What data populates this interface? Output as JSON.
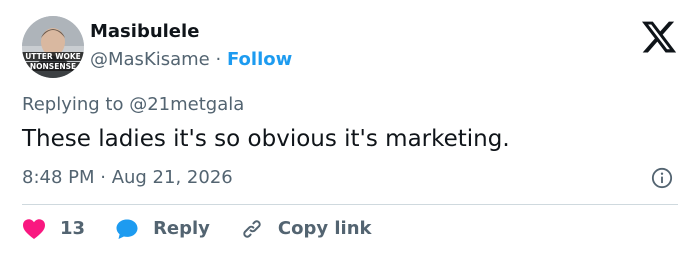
{
  "author": {
    "name": "Masibulele",
    "handle": "@MasKisame",
    "separator": "·",
    "follow_label": "Follow",
    "avatar_text_top": "UTTER WOKE",
    "avatar_text_bottom": "NONSENSE"
  },
  "reply_context": {
    "prefix": "Replying to ",
    "mention": "@21metgala"
  },
  "tweet": {
    "text": "These ladies it's so obvious it's marketing.",
    "timestamp": "8:48 PM · Aug 21, 2026"
  },
  "actions": {
    "like_count": "13",
    "reply_label": "Reply",
    "copy_link_label": "Copy link"
  },
  "colors": {
    "accent": "#1d9bf0",
    "like": "#f91880",
    "text": "#0f1419",
    "muted": "#536471",
    "divider": "#cfd9de"
  },
  "icons": {
    "platform": "x-logo-icon",
    "info": "info-icon",
    "like": "heart-icon",
    "reply": "reply-bubble-icon",
    "copy": "link-icon"
  }
}
